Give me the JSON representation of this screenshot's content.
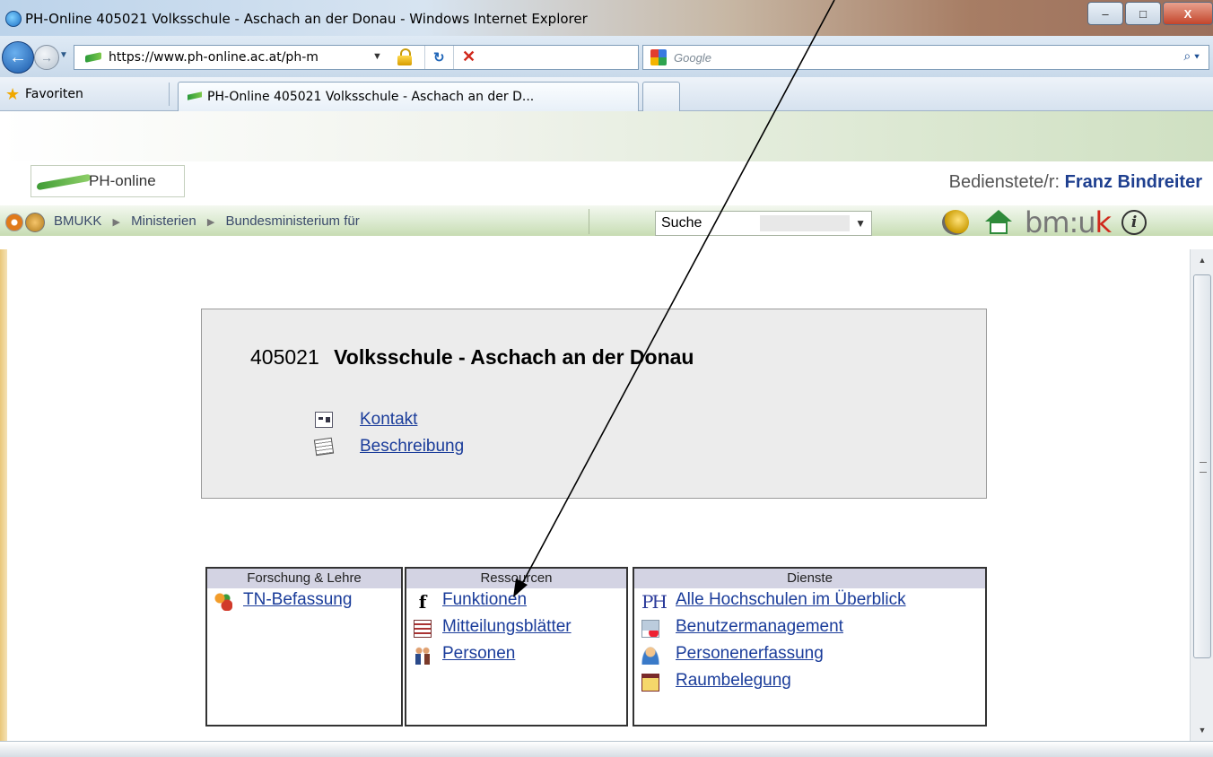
{
  "window": {
    "title": "PH-Online 405021 Volksschule - Aschach an der Donau - Windows Internet Explorer",
    "controls": {
      "minimize": "–",
      "maximize": "□",
      "close": "X"
    }
  },
  "browser": {
    "url": "https://www.ph-online.ac.at/ph-m",
    "search_placeholder": "Google",
    "favorites_label": "Favoriten",
    "tab_title": "PH-Online 405021 Volksschule - Aschach an der D..."
  },
  "app": {
    "logo_text": "PH-online",
    "user_prefix": "Bedienstete/r:",
    "user_name": "Franz Bindreiter",
    "breadcrumbs": [
      "BMUKK",
      "Ministerien",
      "Bundesministerium für"
    ],
    "search_label": "Suche",
    "brand": {
      "bm": "bm:u",
      "k": "k"
    }
  },
  "org": {
    "code": "405021",
    "name": "Volksschule - Aschach an der Donau",
    "links": [
      {
        "label": "Kontakt",
        "icon": "contact-card-icon"
      },
      {
        "label": "Beschreibung",
        "icon": "description-icon"
      }
    ]
  },
  "sections": [
    {
      "title": "Forschung & Lehre",
      "items": [
        {
          "label": "TN-Befassung",
          "icon": "tn-icon"
        }
      ]
    },
    {
      "title": "Ressourcen",
      "items": [
        {
          "label": "Funktionen",
          "icon": "functions-icon"
        },
        {
          "label": "Mitteilungsblätter",
          "icon": "newsletter-icon"
        },
        {
          "label": "Personen",
          "icon": "persons-icon"
        }
      ]
    },
    {
      "title": "Dienste",
      "items": [
        {
          "label": "Alle Hochschulen im Überblick",
          "icon": "ph-icon"
        },
        {
          "label": "Benutzermanagement",
          "icon": "user-management-icon"
        },
        {
          "label": "Personenerfassung",
          "icon": "person-registration-icon"
        },
        {
          "label": "Raumbelegung",
          "icon": "room-booking-icon"
        }
      ]
    }
  ],
  "colors": {
    "link": "#1a3c9a",
    "section_header": "#d3d3e3",
    "user_name": "#1e3f8f"
  }
}
